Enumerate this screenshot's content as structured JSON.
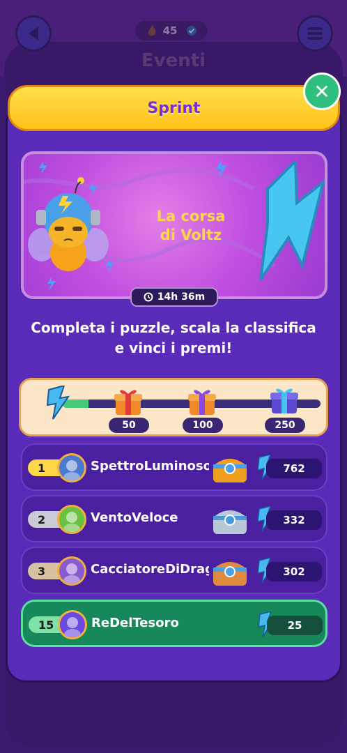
{
  "header": {
    "score_value": "45",
    "page_title": "Eventi"
  },
  "modal": {
    "title": "Sprint",
    "event_name_line1": "La corsa",
    "event_name_line2": "di Voltz",
    "timer": "14h 36m",
    "description": "Completa i puzzle, scala la classifica e vinci i premi!"
  },
  "progress": {
    "current": 25,
    "max": 250,
    "milestones": [
      "50",
      "100",
      "250"
    ]
  },
  "leaderboard": [
    {
      "rank": "1",
      "name": "SpettroLuminoso",
      "score": "762",
      "chest": "gold"
    },
    {
      "rank": "2",
      "name": "VentoVeloce",
      "score": "332",
      "chest": "silver"
    },
    {
      "rank": "3",
      "name": "CacciatoreDiDraghi",
      "score": "302",
      "chest": "bronze"
    },
    {
      "rank": "15",
      "name": "ReDelTesoro",
      "score": "25",
      "chest": "none"
    }
  ],
  "colors": {
    "accent_purple": "#5a2ab8",
    "banner_yellow": "#ffd23a",
    "self_row_green": "#17885a",
    "rank_gold": "#ffd84a",
    "rank_silver": "#c9ccd8",
    "rank_bronze": "#d9c2a0",
    "rank_self": "#7ee2a8"
  }
}
